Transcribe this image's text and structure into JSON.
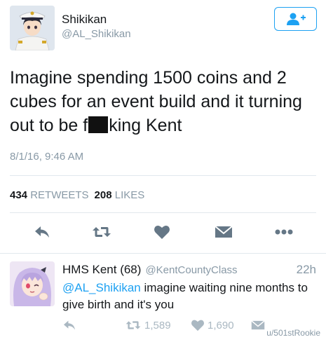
{
  "main_tweet": {
    "display_name": "Shikikan",
    "handle": "@AL_Shikikan",
    "text_part1": "Imagine spending 1500 coins and 2 cubes for an event build and it turning out to be f",
    "text_part2": "king Kent",
    "timestamp": "8/1/16, 9:46 AM",
    "retweet_count": "434",
    "retweet_label": "RETWEETS",
    "like_count": "208",
    "like_label": "LIKES"
  },
  "reply_tweet": {
    "display_name": "HMS Kent (68)",
    "handle": "@KentCountyClass",
    "time": "22h",
    "mention": "@AL_Shikikan",
    "text": " imagine waiting nine months to give birth and it's you",
    "retweets": "1,589",
    "likes": "1,690"
  },
  "watermark": "u/501stRookie",
  "colors": {
    "accent": "#1da1f2",
    "muted": "#8899a6",
    "text": "#14171a",
    "action_icon": "#aab8c2"
  }
}
